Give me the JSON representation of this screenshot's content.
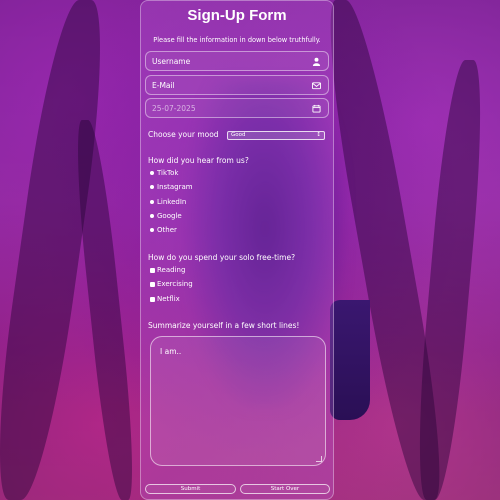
{
  "form": {
    "title": "Sign-Up Form",
    "subtitle": "Please fill the information in down below truthfully.",
    "username_placeholder": "Username",
    "email_placeholder": "E-Mail",
    "date_value": "25-07-2025",
    "mood_label": "Choose your mood",
    "mood_selected": "Good",
    "hear_label": "How did you hear from us?",
    "hear_options": [
      "TikTok",
      "Instagram",
      "LinkedIn",
      "Google",
      "Other"
    ],
    "freetime_label": "How do you spend your solo free-time?",
    "freetime_options": [
      "Reading",
      "Exercising",
      "Netflix"
    ],
    "summary_label": "Summarize yourself in a few short lines!",
    "summary_value": "I am..",
    "submit_label": "Submit",
    "startover_label": "Start Over"
  },
  "icons": {
    "username": "user-icon",
    "email": "mail-icon",
    "date": "calendar-icon",
    "select_caret": "chevron-down-icon"
  },
  "colors": {
    "background": "#7d2c98",
    "panel": "rgba(190,100,220,0.28)",
    "text": "#ffffff"
  }
}
